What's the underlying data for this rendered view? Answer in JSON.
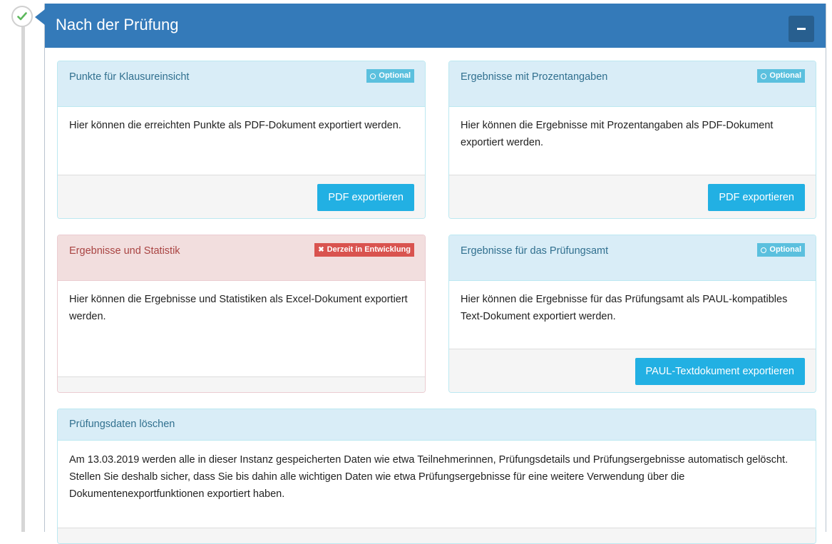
{
  "section": {
    "title": "Nach der Prüfung",
    "collapse_icon": "minus-icon",
    "status_icon": "check-icon",
    "status_color": "#5cb85c",
    "header_color": "#347ab9"
  },
  "cards": [
    {
      "title": "Punkte für Klausureinsicht",
      "badge": "Optional",
      "badge_icon": "circle-icon",
      "body": "Hier können die erreichten Punkte als PDF-Dokument exportiert werden.",
      "button": "PDF exportieren"
    },
    {
      "title": "Ergebnisse mit Prozentangaben",
      "badge": "Optional",
      "badge_icon": "circle-icon",
      "body": "Hier können die Ergebnisse mit Prozentangaben als PDF-Dokument exportiert werden.",
      "button": "PDF exportieren"
    },
    {
      "title": "Ergebnisse und Statistik",
      "badge": "Derzeit in Entwicklung",
      "badge_icon": "x-icon",
      "body": "Hier können die Ergebnisse und Statistiken als Excel-Dokument exportiert werden."
    },
    {
      "title": "Ergebnisse für das Prüfungsamt",
      "badge": "Optional",
      "badge_icon": "circle-icon",
      "body": "Hier können die Ergebnisse für das Prüfungsamt als PAUL-kompatibles Text-Dokument exportiert werden.",
      "button": "PAUL-Textdokument exportieren"
    }
  ],
  "delete_notice": {
    "title": "Prüfungsdaten löschen",
    "body": "Am 13.03.2019 werden alle in dieser Instanz gespeicherten Daten wie etwa Teilnehmerinnen, Prüfungsdetails und Prüfungsergebnisse automatisch gelöscht. Stellen Sie deshalb sicher, dass Sie bis dahin alle wichtigen Daten wie etwa Prüfungsergebnisse für eine weitere Verwendung über die Dokumentenexportfunktionen exportiert haben."
  },
  "colors": {
    "info_bg": "#d9edf7",
    "info_text": "#31708f",
    "danger_bg": "#f2dede",
    "danger_text": "#a94442",
    "button": "#22b0e3",
    "badge_info": "#5bc0de",
    "badge_danger": "#d9534f"
  }
}
